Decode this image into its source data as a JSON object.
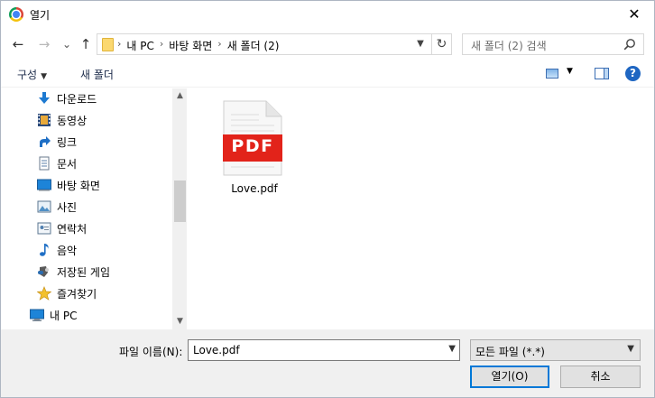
{
  "window": {
    "title": "열기",
    "close_glyph": "✕"
  },
  "nav": {
    "back": "←",
    "forward": "→",
    "recent": "⌄",
    "up": "↑",
    "breadcrumbs": [
      "내 PC",
      "바탕 화면",
      "새 폴더 (2)"
    ],
    "separator": "›",
    "refresh": "↻",
    "search_placeholder": "새 폴더 (2) 검색"
  },
  "toolbar": {
    "organize": "구성",
    "new_folder": "새 폴더",
    "help": "?"
  },
  "tree": [
    {
      "label": "다운로드",
      "icon": "download-icon"
    },
    {
      "label": "동영상",
      "icon": "video-icon"
    },
    {
      "label": "링크",
      "icon": "link-icon"
    },
    {
      "label": "문서",
      "icon": "document-icon"
    },
    {
      "label": "바탕 화면",
      "icon": "desktop-icon"
    },
    {
      "label": "사진",
      "icon": "picture-icon"
    },
    {
      "label": "연락처",
      "icon": "contacts-icon"
    },
    {
      "label": "음악",
      "icon": "music-icon"
    },
    {
      "label": "저장된 게임",
      "icon": "saved-games-icon"
    },
    {
      "label": "즐겨찾기",
      "icon": "favorites-icon"
    }
  ],
  "tree_root": {
    "label": "내 PC",
    "icon": "computer-icon"
  },
  "files": [
    {
      "name": "Love.pdf",
      "badge": "PDF"
    }
  ],
  "bottom": {
    "filename_label": "파일 이름(N):",
    "filename_value": "Love.pdf",
    "filetype_value": "모든 파일 (*.*)",
    "open_label": "열기(O)",
    "cancel_label": "취소"
  },
  "colors": {
    "accent": "#0078d7",
    "pdf_red": "#e2231a",
    "folder": "#fbd870"
  }
}
